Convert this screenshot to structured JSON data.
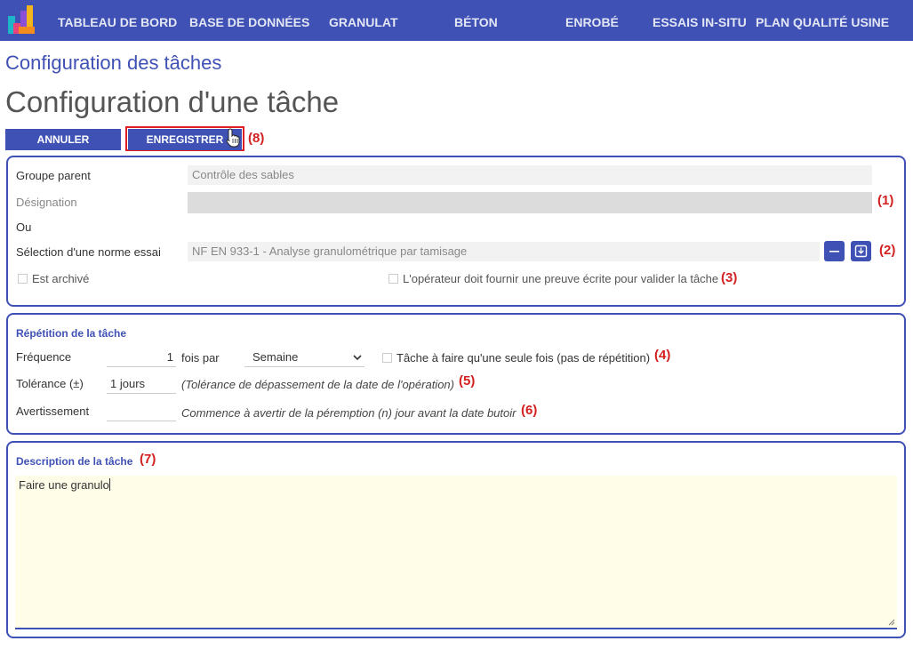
{
  "nav": {
    "items": [
      "TABLEAU DE BORD",
      "BASE DE DONNÉES",
      "GRANULAT",
      "BÉTON",
      "ENROBÉ",
      "ESSAIS IN-SITU",
      "PLAN QUALITÉ USINE"
    ]
  },
  "breadcrumb": "Configuration des tâches",
  "page_title": "Configuration d'une tâche",
  "actions": {
    "cancel_label": "ANNULER",
    "save_label": "ENREGISTRER"
  },
  "callouts": [
    "(1)",
    "(2)",
    "(3)",
    "(4)",
    "(5)",
    "(6)",
    "(7)",
    "(8)"
  ],
  "task": {
    "parent_group_label": "Groupe parent",
    "parent_group_value": "Contrôle des sables",
    "designation_label": "Désignation",
    "designation_value": "",
    "or_label": "Ou",
    "norm_label": "Sélection d'une norme essai",
    "norm_value": "NF EN 933-1 - Analyse granulométrique par tamisage",
    "archived_label": "Est archivé",
    "archived_checked": false,
    "proof_label": "L'opérateur doit fournir une preuve écrite pour valider la tâche",
    "proof_checked": false
  },
  "repetition": {
    "title": "Répétition de la tâche",
    "frequency_label": "Fréquence",
    "frequency_value": "1",
    "per_label": "fois par",
    "period_value": "Semaine",
    "once_label": "Tâche à faire qu'une seule fois (pas de répétition)",
    "once_checked": false,
    "tolerance_label": "Tolérance (±)",
    "tolerance_value": "1 jours",
    "tolerance_hint": "(Tolérance de dépassement de la date de l'opération)",
    "warning_label": "Avertissement",
    "warning_value": "",
    "warning_hint": "Commence à avertir de la péremption (n) jour avant la date butoir"
  },
  "description": {
    "title": "Description de la tâche",
    "value": "Faire une granulo"
  },
  "colors": {
    "primary": "#3f51b5",
    "callout": "#d32020",
    "description_bg": "#fffde7"
  }
}
